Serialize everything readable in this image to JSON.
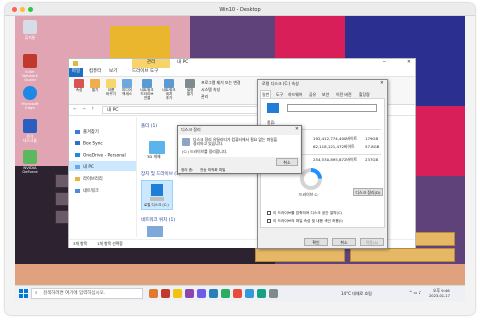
{
  "host": {
    "title": "Win10 - Desktop"
  },
  "desktop": {
    "icons": [
      {
        "label": "휴지통",
        "color": "#d7dde6"
      },
      {
        "label": "Killer\nNetwork\nGuard",
        "color": "#c0392b"
      },
      {
        "label": "Microsoft\nEdge",
        "color": "#1e88e5"
      },
      {
        "label": "원격\n데스크톱",
        "color": "#2b5fbf"
      },
      {
        "label": "NVIDIA\nGeForce",
        "color": "#5cb85c"
      }
    ]
  },
  "explorer": {
    "title": "내 PC",
    "ribbon_context_tab": "관리",
    "ribbon_tabs": [
      "파일",
      "컴퓨터",
      "보기",
      "드라이브 도구"
    ],
    "ribbon_buttons": [
      {
        "label": "속성",
        "color": "#d9534f"
      },
      {
        "label": "열기",
        "color": "#f0ad4e"
      },
      {
        "label": "이름\n바꾸기",
        "color": "#f5d76e"
      },
      {
        "label": "미디어\n액세스",
        "color": "#6fa8dc"
      },
      {
        "label": "네트워크\n드라이브\n연결",
        "color": "#5b9bd5"
      },
      {
        "label": "네트워크\n위치\n추가",
        "color": "#5b9bd5"
      },
      {
        "label": "설정\n열기",
        "color": "#7f8c8d"
      }
    ],
    "ribbon_right_items": [
      "프로그램 제거 또는 변경",
      "시스템 속성",
      "관리"
    ],
    "address": "내 PC",
    "nav_items": [
      {
        "label": "즐겨찾기",
        "color": "#3b7bd6"
      },
      {
        "label": "Box Sync",
        "color": "#2a73c7"
      },
      {
        "label": "OneDrive - Personal",
        "color": "#1e88e5"
      },
      {
        "label": "내 PC",
        "color": "#6aa7e8"
      },
      {
        "label": "라이브러리",
        "color": "#e5b646"
      },
      {
        "label": "네트워크",
        "color": "#4c8bd8"
      }
    ],
    "section_folders": "폴더 (1)",
    "folder_item": "3D 개체",
    "section_drives": "장치 및 드라이브 (1)",
    "drive_item": "로컬 디스크 (C:)",
    "section_network": "네트워크 위치 (1)",
    "status_count": "3개 항목",
    "status_selected": "1개 항목 선택함"
  },
  "properties": {
    "title": "로컬 디스크 (C:) 속성",
    "tabs": [
      "일반",
      "도구",
      "하드웨어",
      "공유",
      "보안",
      "이전 버전",
      "할당량"
    ],
    "drive_type_label": "종류:",
    "rows": [
      {
        "bytes": "192,412,774,400바이트",
        "size": "179GB"
      },
      {
        "bytes": "62,118,121,472바이트",
        "size": "57.8GB"
      },
      {
        "bytes": "254,530,895,872바이트",
        "size": "237GB"
      }
    ],
    "drive_label": "드라이브 C:",
    "cleanup_button": "디스크 정리(D)",
    "option1": "이 드라이브를 압축하여 디스크 공간 절약(C)",
    "option2": "이 드라이브의 파일 속성 및 내용 색인 허용(I)",
    "ok": "확인",
    "cancel": "취소",
    "apply": "적용(A)",
    "used_fraction": 0.24
  },
  "cleanup": {
    "title": "디스크 정리",
    "message": "디스크 정리 유틸리티가 컴퓨터에서 필요 없는 파일을\n정리하고 있습니다.",
    "item": "(C:) 드라이브를 정리합니다.",
    "cancel": "취소",
    "col1": "정리 중:",
    "col2": "전송 최적화 파일"
  },
  "taskbar": {
    "search_placeholder": "검색하려면 여기에 입력하십시오.",
    "apps": [
      "#e07a2e",
      "#c0392b",
      "#f1c40f",
      "#8e44ad",
      "#6c5ce7",
      "#2980b9",
      "#27ae60",
      "#e74c3c",
      "#3498db",
      "#16a085",
      "#7f8c8d"
    ],
    "weather": "14°C 대체로 흐림",
    "time": "오후 9:46",
    "date": "2023-01-17"
  },
  "colors": {
    "accent": "#0078d4",
    "donut_used": "#1e90ff",
    "donut_free": "#d4d4d4"
  }
}
